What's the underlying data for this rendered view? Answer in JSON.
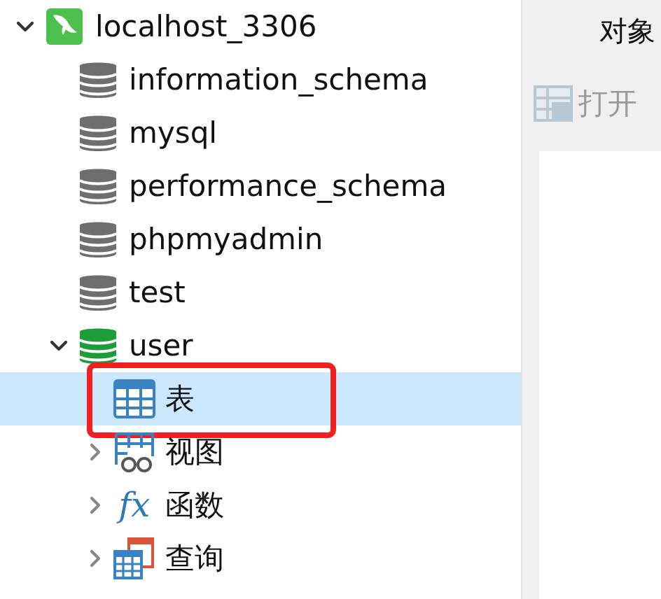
{
  "navigator": {
    "tree": [
      {
        "label": "localhost_3306",
        "kind": "connection",
        "expanded": true,
        "children": [
          {
            "label": "information_schema",
            "kind": "database",
            "open": false
          },
          {
            "label": "mysql",
            "kind": "database",
            "open": false
          },
          {
            "label": "performance_schema",
            "kind": "database",
            "open": false
          },
          {
            "label": "phpmyadmin",
            "kind": "database",
            "open": false
          },
          {
            "label": "test",
            "kind": "database",
            "open": false
          },
          {
            "label": "user",
            "kind": "database",
            "open": true,
            "expanded": true,
            "children": [
              {
                "label": "表",
                "kind": "table",
                "selected": true,
                "highlighted": true
              },
              {
                "label": "视图",
                "kind": "view",
                "selected": false,
                "highlighted": false,
                "expanded": false
              },
              {
                "label": "函数",
                "kind": "function",
                "glyph": "fx",
                "selected": false,
                "highlighted": false,
                "expanded": false
              },
              {
                "label": "查询",
                "kind": "query",
                "selected": false,
                "highlighted": false,
                "expanded": false
              }
            ]
          }
        ]
      }
    ]
  },
  "objects": {
    "tabs": [
      {
        "label": "对象",
        "selected": true
      }
    ],
    "toolbar": [
      {
        "label": "打开",
        "disabled": true
      }
    ]
  }
}
